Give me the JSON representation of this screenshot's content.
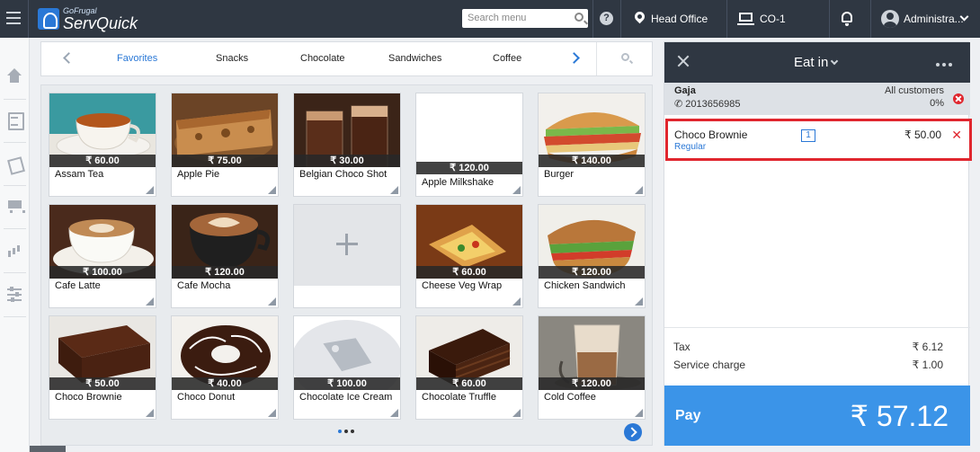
{
  "topbar": {
    "logo_small": "GoFrugal",
    "logo_big": "ServQuick",
    "search_placeholder": "Search menu",
    "location": "Head Office",
    "counter": "CO-1",
    "user": "Administra..."
  },
  "categories": {
    "items": [
      "Favorites",
      "Snacks",
      "Chocolate",
      "Sandwiches",
      "Coffee"
    ],
    "active": "Favorites"
  },
  "products": [
    {
      "name": "Assam Tea",
      "price": "₹ 60.00"
    },
    {
      "name": "Apple Pie",
      "price": "₹ 75.00"
    },
    {
      "name": "Belgian Choco Shot",
      "price": "₹ 30.00"
    },
    {
      "name": "Apple Milkshake",
      "price": "₹ 120.00"
    },
    {
      "name": "Burger",
      "price": "₹ 140.00"
    },
    {
      "name": "Cafe Latte",
      "price": "₹ 100.00"
    },
    {
      "name": "Cafe Mocha",
      "price": "₹ 120.00"
    },
    {
      "name": "Cheese Veg Wrap",
      "price": "₹ 60.00"
    },
    {
      "name": "Chicken Sandwich",
      "price": "₹ 120.00"
    },
    {
      "name": "Choco Brownie",
      "price": "₹ 50.00"
    },
    {
      "name": "Choco Donut",
      "price": "₹ 40.00"
    },
    {
      "name": "Chocolate Ice Cream",
      "price": "₹ 100.00"
    },
    {
      "name": "Chocolate Truffle",
      "price": "₹ 60.00"
    },
    {
      "name": "Cold Coffee",
      "price": "₹ 120.00"
    }
  ],
  "order": {
    "mode": "Eat in",
    "customer": {
      "name": "Gaja",
      "phone": "2013656985",
      "type": "All customers",
      "discount": "0%"
    },
    "items": [
      {
        "name": "Choco Brownie",
        "variant": "Regular",
        "qty": "1",
        "price": "₹ 50.00"
      }
    ],
    "tax_label": "Tax",
    "tax": "₹ 6.12",
    "service_label": "Service charge",
    "service": "₹ 1.00",
    "pay_label": "Pay",
    "total": "₹ 57.12"
  },
  "colors": {
    "topbar": "#2f3742",
    "accent": "#2a78d6",
    "pay": "#3b94e8",
    "alert": "#e0262e"
  }
}
